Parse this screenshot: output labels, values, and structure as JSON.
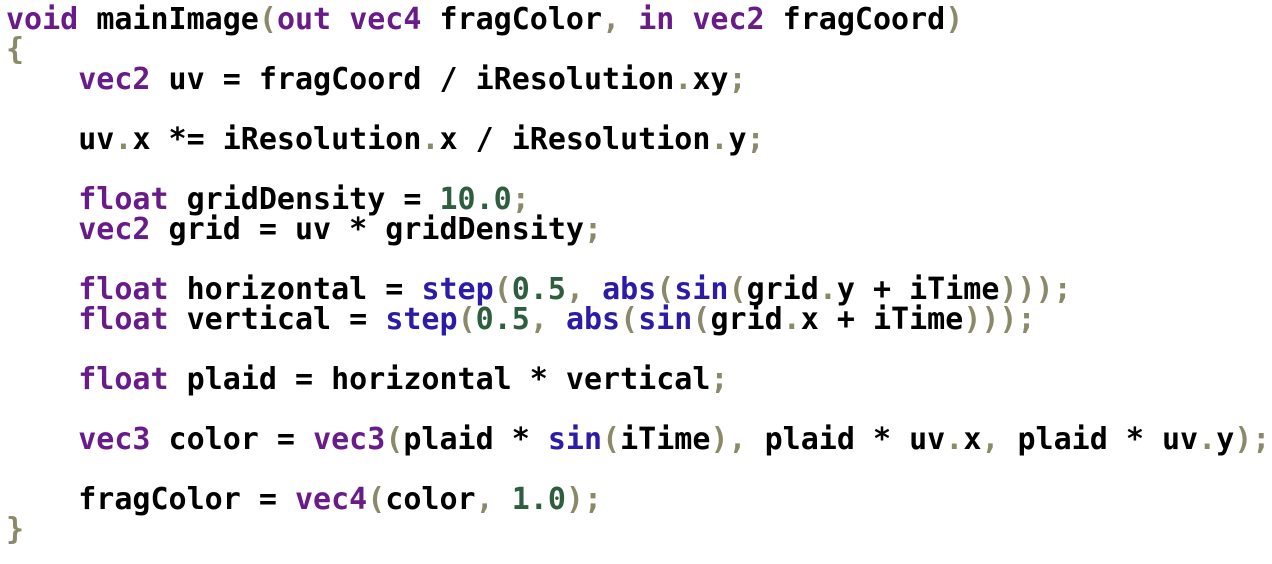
{
  "colors": {
    "keyword": "#6a1b8a",
    "builtin_function": "#2b1ba8",
    "number": "#2e5e3e",
    "punctuation": "#8a8a6a",
    "identifier": "#000000",
    "background": "#ffffff"
  },
  "code": {
    "lines": [
      [
        {
          "t": "void",
          "c": "kw"
        },
        {
          "t": " ",
          "c": "id"
        },
        {
          "t": "mainImage",
          "c": "id"
        },
        {
          "t": "(",
          "c": "pun"
        },
        {
          "t": "out",
          "c": "kw"
        },
        {
          "t": " ",
          "c": "id"
        },
        {
          "t": "vec4",
          "c": "kw"
        },
        {
          "t": " fragColor",
          "c": "id"
        },
        {
          "t": ",",
          "c": "pun"
        },
        {
          "t": " ",
          "c": "id"
        },
        {
          "t": "in",
          "c": "kw"
        },
        {
          "t": " ",
          "c": "id"
        },
        {
          "t": "vec2",
          "c": "kw"
        },
        {
          "t": " fragCoord",
          "c": "id"
        },
        {
          "t": ")",
          "c": "pun"
        }
      ],
      [
        {
          "t": "{",
          "c": "pun"
        }
      ],
      [
        {
          "t": "    ",
          "c": "id"
        },
        {
          "t": "vec2",
          "c": "kw"
        },
        {
          "t": " uv = fragCoord / iResolution",
          "c": "id"
        },
        {
          "t": ".",
          "c": "pun"
        },
        {
          "t": "xy",
          "c": "id"
        },
        {
          "t": ";",
          "c": "pun"
        }
      ],
      [],
      [
        {
          "t": "    uv",
          "c": "id"
        },
        {
          "t": ".",
          "c": "pun"
        },
        {
          "t": "x *= iResolution",
          "c": "id"
        },
        {
          "t": ".",
          "c": "pun"
        },
        {
          "t": "x / iResolution",
          "c": "id"
        },
        {
          "t": ".",
          "c": "pun"
        },
        {
          "t": "y",
          "c": "id"
        },
        {
          "t": ";",
          "c": "pun"
        }
      ],
      [],
      [
        {
          "t": "    ",
          "c": "id"
        },
        {
          "t": "float",
          "c": "kw"
        },
        {
          "t": " gridDensity = ",
          "c": "id"
        },
        {
          "t": "10.0",
          "c": "num"
        },
        {
          "t": ";",
          "c": "pun"
        }
      ],
      [
        {
          "t": "    ",
          "c": "id"
        },
        {
          "t": "vec2",
          "c": "kw"
        },
        {
          "t": " grid = uv * gridDensity",
          "c": "id"
        },
        {
          "t": ";",
          "c": "pun"
        }
      ],
      [],
      [
        {
          "t": "    ",
          "c": "id"
        },
        {
          "t": "float",
          "c": "kw"
        },
        {
          "t": " horizontal = ",
          "c": "id"
        },
        {
          "t": "step",
          "c": "fn"
        },
        {
          "t": "(",
          "c": "pun"
        },
        {
          "t": "0.5",
          "c": "num"
        },
        {
          "t": ",",
          "c": "pun"
        },
        {
          "t": " ",
          "c": "id"
        },
        {
          "t": "abs",
          "c": "fn"
        },
        {
          "t": "(",
          "c": "pun"
        },
        {
          "t": "sin",
          "c": "fn"
        },
        {
          "t": "(",
          "c": "pun"
        },
        {
          "t": "grid",
          "c": "id"
        },
        {
          "t": ".",
          "c": "pun"
        },
        {
          "t": "y + iTime",
          "c": "id"
        },
        {
          "t": ")));",
          "c": "pun"
        }
      ],
      [
        {
          "t": "    ",
          "c": "id"
        },
        {
          "t": "float",
          "c": "kw"
        },
        {
          "t": " vertical = ",
          "c": "id"
        },
        {
          "t": "step",
          "c": "fn"
        },
        {
          "t": "(",
          "c": "pun"
        },
        {
          "t": "0.5",
          "c": "num"
        },
        {
          "t": ",",
          "c": "pun"
        },
        {
          "t": " ",
          "c": "id"
        },
        {
          "t": "abs",
          "c": "fn"
        },
        {
          "t": "(",
          "c": "pun"
        },
        {
          "t": "sin",
          "c": "fn"
        },
        {
          "t": "(",
          "c": "pun"
        },
        {
          "t": "grid",
          "c": "id"
        },
        {
          "t": ".",
          "c": "pun"
        },
        {
          "t": "x + iTime",
          "c": "id"
        },
        {
          "t": ")));",
          "c": "pun"
        }
      ],
      [],
      [
        {
          "t": "    ",
          "c": "id"
        },
        {
          "t": "float",
          "c": "kw"
        },
        {
          "t": " plaid = horizontal * vertical",
          "c": "id"
        },
        {
          "t": ";",
          "c": "pun"
        }
      ],
      [],
      [
        {
          "t": "    ",
          "c": "id"
        },
        {
          "t": "vec3",
          "c": "kw"
        },
        {
          "t": " color = ",
          "c": "id"
        },
        {
          "t": "vec3",
          "c": "kw"
        },
        {
          "t": "(",
          "c": "pun"
        },
        {
          "t": "plaid * ",
          "c": "id"
        },
        {
          "t": "sin",
          "c": "fn"
        },
        {
          "t": "(",
          "c": "pun"
        },
        {
          "t": "iTime",
          "c": "id"
        },
        {
          "t": "),",
          "c": "pun"
        },
        {
          "t": " plaid * uv",
          "c": "id"
        },
        {
          "t": ".",
          "c": "pun"
        },
        {
          "t": "x",
          "c": "id"
        },
        {
          "t": ",",
          "c": "pun"
        },
        {
          "t": " plaid * uv",
          "c": "id"
        },
        {
          "t": ".",
          "c": "pun"
        },
        {
          "t": "y",
          "c": "id"
        },
        {
          "t": ");",
          "c": "pun"
        }
      ],
      [],
      [
        {
          "t": "    fragColor = ",
          "c": "id"
        },
        {
          "t": "vec4",
          "c": "kw"
        },
        {
          "t": "(",
          "c": "pun"
        },
        {
          "t": "color",
          "c": "id"
        },
        {
          "t": ",",
          "c": "pun"
        },
        {
          "t": " ",
          "c": "id"
        },
        {
          "t": "1.0",
          "c": "num"
        },
        {
          "t": ");",
          "c": "pun"
        }
      ],
      [
        {
          "t": "}",
          "c": "pun"
        }
      ]
    ]
  }
}
